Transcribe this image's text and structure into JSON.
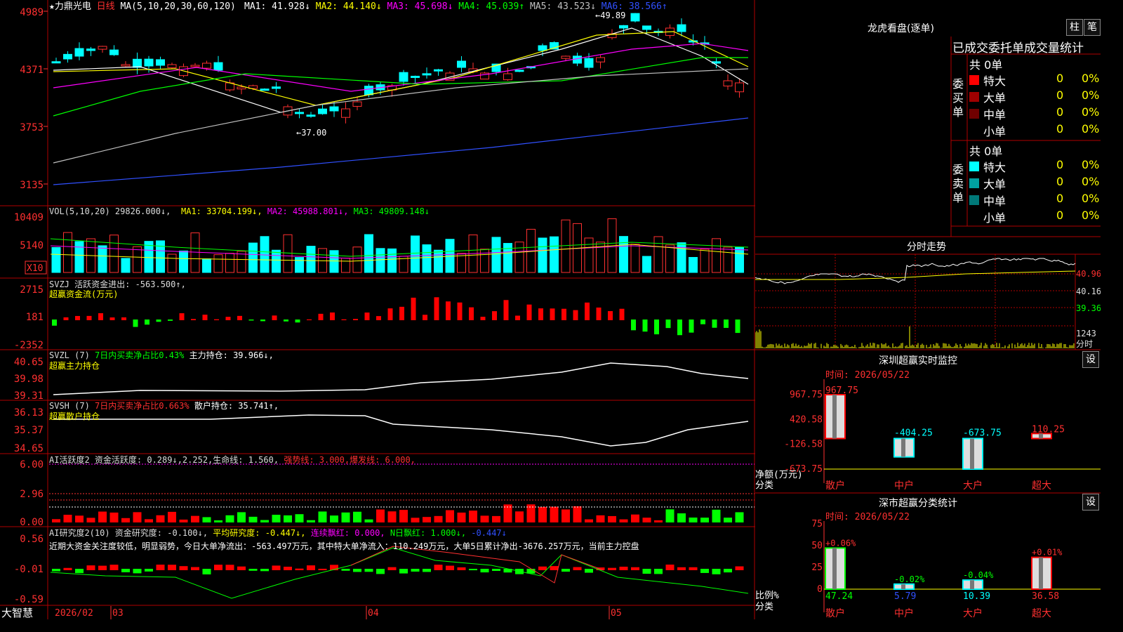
{
  "app": {
    "brand": "大智慧"
  },
  "main_chart": {
    "stock_name": "★力鼎光电",
    "period": "日线",
    "ma_params": "MA(5,10,20,30,60,120)",
    "ma_values": [
      {
        "label": "MA1: 41.928↓",
        "color": "#ffffff"
      },
      {
        "label": "MA2: 44.140↓",
        "color": "#ffff00"
      },
      {
        "label": "MA3: 45.698↓",
        "color": "#ff00ff"
      },
      {
        "label": "MA4: 45.039↑",
        "color": "#00ff00"
      },
      {
        "label": "MA5: 43.523↓",
        "color": "#c0c0c0"
      },
      {
        "label": "MA6: 38.566↑",
        "color": "#3050ff"
      }
    ],
    "y_labels": [
      "4989",
      "4371",
      "3753",
      "3135"
    ],
    "high_marker": "49.89",
    "low_marker": "37.00"
  },
  "volume": {
    "header": "VOL(5,10,20) 29826.000↓,",
    "ma_values": [
      {
        "label": "MA1: 33704.199↓,",
        "color": "#ffff00"
      },
      {
        "label": "MA2: 45988.801↓,",
        "color": "#ff00ff"
      },
      {
        "label": "MA3: 49809.148↓",
        "color": "#00ff00"
      }
    ],
    "y_labels": [
      "10409",
      "5140"
    ],
    "unit": "X10"
  },
  "svzj": {
    "header": "SVZJ  活跃资金进出: -563.500↑,",
    "subtitle": "超赢资金流(万元)",
    "y_labels": [
      "2715",
      "181",
      "-2352"
    ]
  },
  "svzl": {
    "header_a": "SVZL (7)",
    "header_b": "7日内买卖净占比0.43%",
    "header_c": "主力持仓: 39.966↓,",
    "subtitle": "超赢主力持仓",
    "y_labels": [
      "40.65",
      "39.98",
      "39.31"
    ]
  },
  "svsh": {
    "header_a": "SVSH (7)",
    "header_b": "7日内买卖净占比0.663%",
    "header_c": "散户持仓: 35.741↑,",
    "subtitle": "超赢散户持仓",
    "y_labels": [
      "36.13",
      "35.37",
      "34.65"
    ]
  },
  "ai_active": {
    "header_a": "AI活跃度2 资金活跃度: 0.289↓,2.252,生命线: 1.560,",
    "header_b": "强势线: 3.000,爆发线: 6.000,",
    "y_labels": [
      "6.00",
      "2.96",
      "0.00"
    ]
  },
  "ai_research": {
    "header_a": "AI研究度2(10) 资金研究度: -0.100↓,",
    "header_b": "平均研究度: -0.447↓,",
    "header_c": "连续飘红: 0.000,",
    "header_d": "N日飘红: 1.000↓,",
    "header_e": "-0.447↓",
    "comment": "近期大资金关注度较低，明显弱势，今日大单净流出：-563.497万元，其中特大单净流入：110.249万元，大单5日累计净出-3676.257万元，当前主力控盘",
    "y_labels": [
      "0.56",
      "-0.01",
      "-0.59"
    ]
  },
  "x_axis": {
    "labels": [
      "2026/02",
      "03",
      "04",
      "05"
    ]
  },
  "dragon_tiger": {
    "title": "龙虎看盘(逐单)",
    "btn_bar": "柱",
    "btn_pen": "笔",
    "header": "已成交委托单成交量统计",
    "buy_group": {
      "side_label": "委买单",
      "total": "共 0单",
      "rows": [
        {
          "label": "特大",
          "count": "0",
          "pct": "0%",
          "color": "#ff0000"
        },
        {
          "label": "大单",
          "count": "0",
          "pct": "0%",
          "color": "#a00000"
        },
        {
          "label": "中单",
          "count": "0",
          "pct": "0%",
          "color": "#700000"
        },
        {
          "label": "小单",
          "count": "0",
          "pct": "0%",
          "color": "#000000"
        }
      ]
    },
    "sell_group": {
      "side_label": "委卖单",
      "total": "共 0单",
      "rows": [
        {
          "label": "特大",
          "count": "0",
          "pct": "0%",
          "color": "#00ffff"
        },
        {
          "label": "大单",
          "count": "0",
          "pct": "0%",
          "color": "#00a0a0"
        },
        {
          "label": "中单",
          "count": "0",
          "pct": "0%",
          "color": "#007878"
        },
        {
          "label": "小单",
          "count": "0",
          "pct": "0%",
          "color": "#000000"
        }
      ]
    }
  },
  "intraday": {
    "title": "分时走势",
    "y_labels": [
      "40.96",
      "40.16",
      "39.36"
    ],
    "vol_label": "1243",
    "vol_unit": "分时"
  },
  "sz_monitor": {
    "title": "深圳超赢实时监控",
    "settings": "设",
    "time": "时间: 2026/05/22",
    "y_labels": [
      "967.75",
      "420.58",
      "-126.58",
      "-673.75"
    ],
    "y_title_1": "净额(万元)",
    "y_title_2": "分类",
    "categories": [
      "散户",
      "中户",
      "大户",
      "超大"
    ],
    "values": [
      967.75,
      -404.25,
      -673.75,
      110.25
    ],
    "value_labels": [
      "967.75",
      "-404.25",
      "-673.75",
      "110.25"
    ]
  },
  "sz_class": {
    "title": "深市超赢分类统计",
    "settings": "设",
    "time": "时间: 2026/05/22",
    "y_labels": [
      "75",
      "50",
      "25",
      "0"
    ],
    "y_title_1": "比例%",
    "y_title_2": "分类",
    "categories": [
      "散户",
      "中户",
      "大户",
      "超大"
    ],
    "ratios": [
      47.24,
      5.79,
      10.39,
      36.58
    ],
    "ratio_labels": [
      "47.24",
      "5.79",
      "10.39",
      "36.58"
    ],
    "change_labels": [
      "+0.06%",
      "-0.02%",
      "-0.04%",
      "+0.01%"
    ]
  }
}
